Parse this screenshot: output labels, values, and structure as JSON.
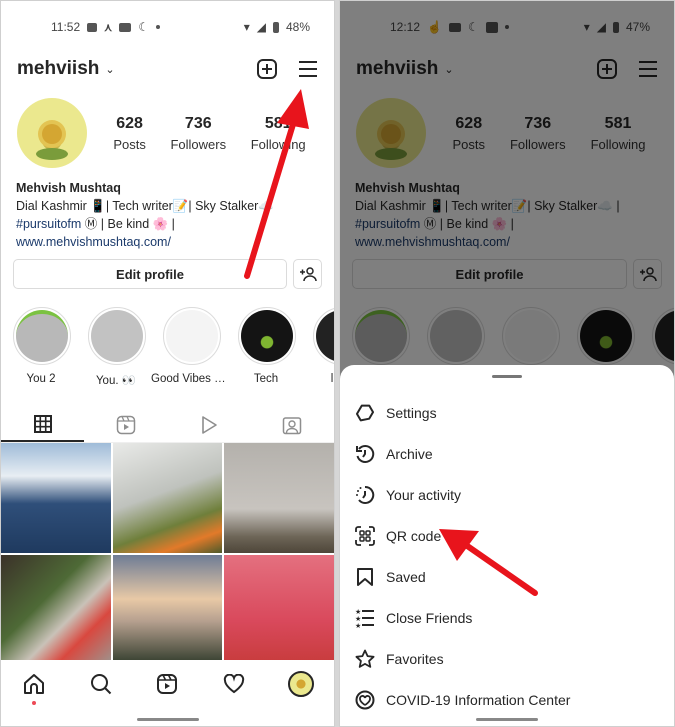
{
  "left_screen": {
    "status_bar": {
      "time": "11:52",
      "battery": "48%"
    },
    "header": {
      "username": "mehviish"
    },
    "stats": [
      {
        "value": "628",
        "label": "Posts"
      },
      {
        "value": "736",
        "label": "Followers"
      },
      {
        "value": "581",
        "label": "Following"
      }
    ],
    "bio": {
      "name": "Mehvish Mushtaq",
      "line1": "Dial Kashmir 📱| Tech writer📝| Sky Stalker☁️",
      "hashtag": "#pursuitofm",
      "line2_rest": " Ⓜ | Be kind 🌸 |",
      "website": "www.mehvishmushtaq.com/"
    },
    "edit_profile_label": "Edit profile",
    "highlights": [
      {
        "label": "You 2",
        "color": "#b8b8b8"
      },
      {
        "label": "You. 👀",
        "color": "#c2c2c2"
      },
      {
        "label": "Good Vibes O...",
        "color": "#f4f4f4"
      },
      {
        "label": "Tech",
        "color": "#141414"
      },
      {
        "label": "little",
        "color": "#222222"
      }
    ],
    "grid_colors": [
      "#5c7fa8",
      "#8a8f7a",
      "#b6b3ad",
      "#5a4a3c",
      "#a59a8e",
      "#d9495c",
      "#a0523d",
      "#c8b8b0",
      "#b69045"
    ]
  },
  "right_screen": {
    "status_bar": {
      "time": "12:12",
      "battery": "47%"
    },
    "header": {
      "username": "mehviish"
    },
    "stats": [
      {
        "value": "628",
        "label": "Posts"
      },
      {
        "value": "736",
        "label": "Followers"
      },
      {
        "value": "581",
        "label": "Following"
      }
    ],
    "bio": {
      "name": "Mehvish Mushtaq",
      "line1": "Dial Kashmir 📱| Tech writer📝| Sky Stalker☁️ |",
      "hashtag": "#pursuitofm",
      "line2_rest": " Ⓜ | Be kind 🌸 |",
      "website": "www.mehvishmushtaq.com/"
    },
    "edit_profile_label": "Edit profile",
    "menu": [
      {
        "label": "Settings",
        "icon": "settings-icon"
      },
      {
        "label": "Archive",
        "icon": "archive-icon"
      },
      {
        "label": "Your activity",
        "icon": "activity-icon"
      },
      {
        "label": "QR code",
        "icon": "qr-code-icon"
      },
      {
        "label": "Saved",
        "icon": "bookmark-icon"
      },
      {
        "label": "Close Friends",
        "icon": "close-friends-icon"
      },
      {
        "label": "Favorites",
        "icon": "star-icon"
      },
      {
        "label": "COVID-19 Information Center",
        "icon": "covid-info-icon"
      }
    ]
  },
  "annotation_color": "#e8141c"
}
